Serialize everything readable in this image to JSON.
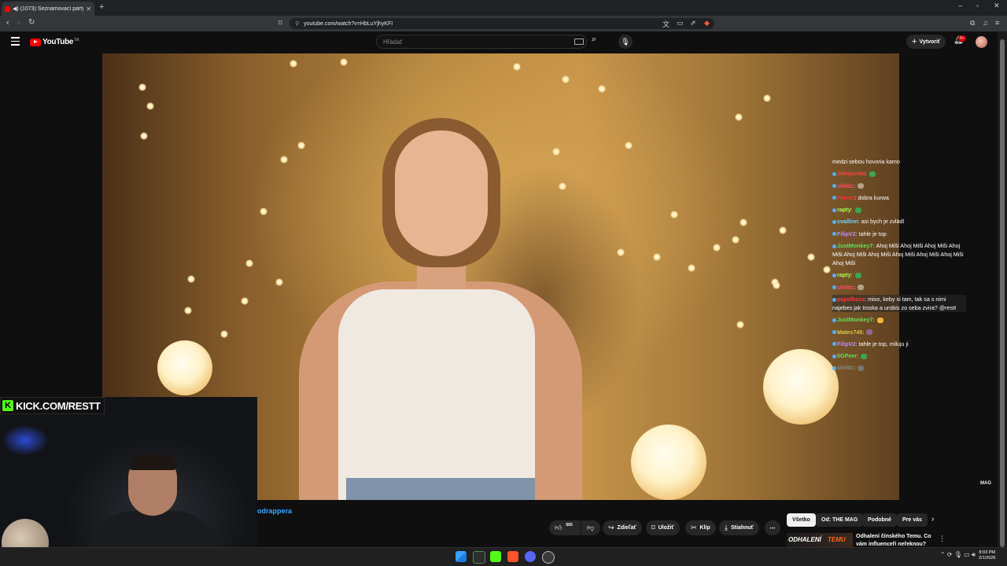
{
  "browser": {
    "tab_title": "(1073) Seznamovací party se",
    "url": "youtube.com/watch?v=HbLuYjhyKFI"
  },
  "youtube": {
    "logo_text": "YouTube",
    "region": "SK",
    "search_placeholder": "Hľadať",
    "create_label": "Vytvoriť",
    "notif_count": "9+"
  },
  "video": {
    "watermark": "MAG"
  },
  "chat": [
    {
      "user": "",
      "user_color": "#ffffff",
      "text": "medzi sebou hovoria kamo"
    },
    {
      "user": "Jelegonda",
      "user_color": "#ff4040",
      "text": "",
      "emote": "#3aa655"
    },
    {
      "user": "shifdc",
      "user_color": "#ff4d6a",
      "text": "",
      "emote": "#b5a08a"
    },
    {
      "user": "Ferren",
      "user_color": "#ff3030",
      "text": "dobra kurwa"
    },
    {
      "user": "rapty",
      "user_color": "#a6ff4d",
      "text": "",
      "emote": "#3aa655"
    },
    {
      "user": "cvallinn",
      "user_color": "#6fd3ff",
      "text": "asi bych je zvlädl"
    },
    {
      "user": "FilipV2",
      "user_color": "#c08cff",
      "text": "tahle je top"
    },
    {
      "user": "JustMonkey7",
      "user_color": "#5ce35c",
      "text": "Ahoj Miši  Ahoj Miši  Ahoj Miši  Ahoj Miši  Ahoj Miši  Ahoj Miši  Ahoj Miši  Ahoj Miši  Ahoj Miši  Ahoj Miši"
    },
    {
      "user": "rapty",
      "user_color": "#a6ff4d",
      "text": "",
      "emote": "#3aa655"
    },
    {
      "user": "shifdc",
      "user_color": "#ff4d6a",
      "text": "",
      "emote": "#b5a08a"
    },
    {
      "user": "papelbass",
      "user_color": "#ff3a3a",
      "text": "miso, keby si tam, tak sa s nimi najebes jak troska a urobis zo seba zvira? @restt",
      "highlight": true
    },
    {
      "user": "JustMonkey7",
      "user_color": "#5ce35c",
      "text": "",
      "emote": "#f0b83a"
    },
    {
      "user": "Mates745",
      "user_color": "#d8c44a",
      "text": "",
      "emote": "#8a6a9a"
    },
    {
      "user": "FilipV2",
      "user_color": "#c08cff",
      "text": "tahle je top, miluju ji"
    },
    {
      "user": "0GPeer",
      "user_color": "#5ce35c",
      "text": "",
      "emote": "#3aa655"
    },
    {
      "user": "shifdc",
      "user_color": "#888888",
      "text": "",
      "emote": "#777777"
    }
  ],
  "webcam": {
    "kick_label": "KICK.COM/RESTT"
  },
  "below": {
    "channel_name": "odrappera",
    "like_count": "565",
    "share_label": "Zdieľať",
    "save_label": "Uložiť",
    "clip_label": "Klip",
    "download_label": "Stiahnuť"
  },
  "chips": [
    "Všetko",
    "Od: THE MAG",
    "Podobné",
    "Pre vás"
  ],
  "recommendation": {
    "thumb_text_1": "ODHALENÍ",
    "thumb_text_2": "TEMU",
    "title": "Odhalení čínského Temu. Co vám influenceři neřeknou?"
  },
  "taskbar": {
    "time": "8:03 PM",
    "date": "2/1/2026"
  },
  "colors": {
    "accent_red": "#ff0000",
    "link_blue": "#3ea6ff",
    "kick_green": "#53fc18"
  }
}
